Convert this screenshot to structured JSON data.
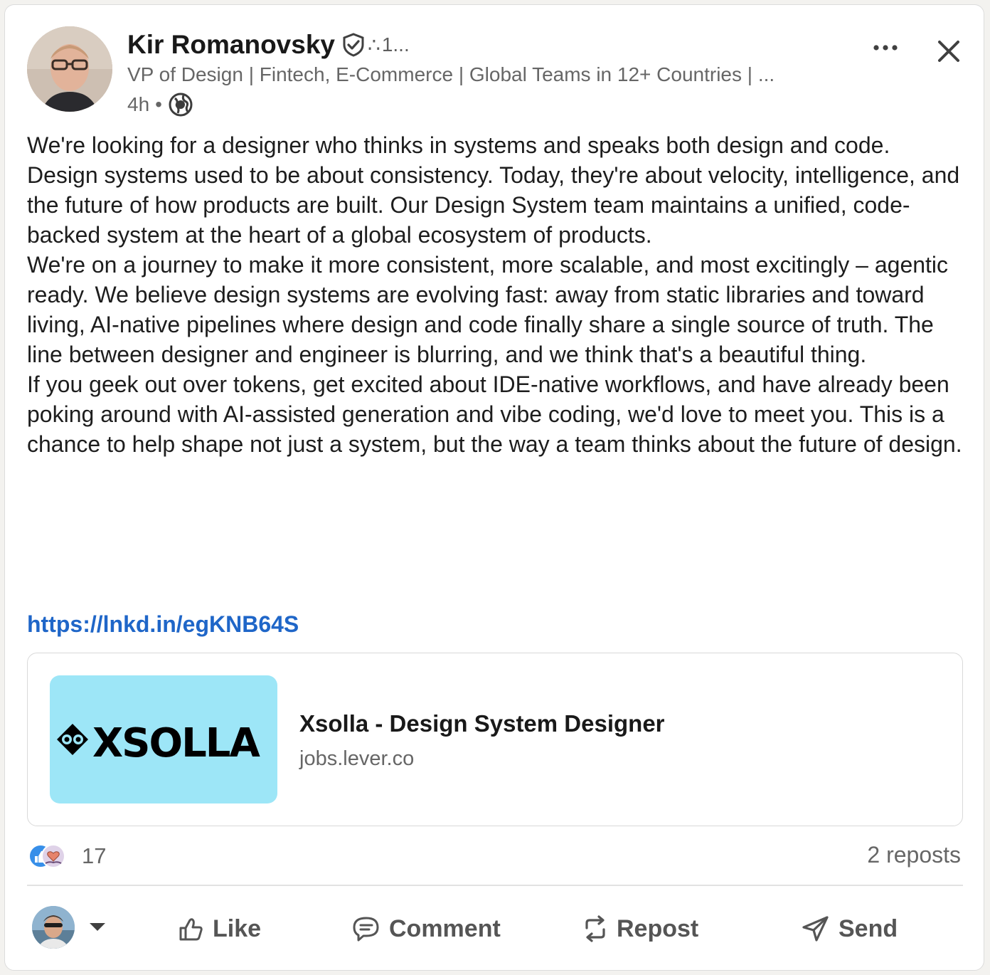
{
  "post": {
    "author": {
      "name": "Kir Romanovsky",
      "connection_degree": "1...",
      "headline": "VP of Design | Fintech, E-Commerce | Global Teams in 12+ Countries | ...",
      "time": "4h",
      "visibility_icon": "globe-icon",
      "verified_icon": "verified-shield-icon"
    },
    "more_icon": "more-options-icon",
    "close_icon": "close-icon",
    "paragraphs": [
      "We're looking for a designer who thinks in systems and speaks both design and code.",
      "Design systems used to be about consistency. Today, they're about velocity, intelligence, and the future of how products are built. Our Design System team maintains a unified, code-backed system at the heart of a global ecosystem of products.",
      "We're on a journey to make it more consistent, more scalable, and most excitingly – agentic ready. We believe design systems are evolving fast: away from static libraries and toward living, AI-native pipelines where design and code finally share a single source of truth. The line between designer and engineer is blurring, and we think that's a beautiful thing.",
      "If you geek out over tokens, get excited about IDE-native workflows, and have already been poking around with AI-assisted generation and vibe coding, we'd love to meet you. This is a chance to help shape not just a system, but the way a team thinks about the future of design."
    ],
    "link": "https://lnkd.in/egKNB64S",
    "preview": {
      "logo_text": "XSOLLA",
      "title": "Xsolla - Design System Designer",
      "domain": "jobs.lever.co",
      "thumb_color": "#9de6f7"
    },
    "reactions": {
      "count": "17",
      "icons": [
        "like-reaction-icon",
        "love-reaction-icon"
      ]
    },
    "reposts": "2 reposts"
  },
  "actions": {
    "like": "Like",
    "comment": "Comment",
    "repost": "Repost",
    "send": "Send"
  },
  "colors": {
    "link": "#1f66c8",
    "muted_text": "#666666",
    "like_blue": "#378fe9"
  }
}
